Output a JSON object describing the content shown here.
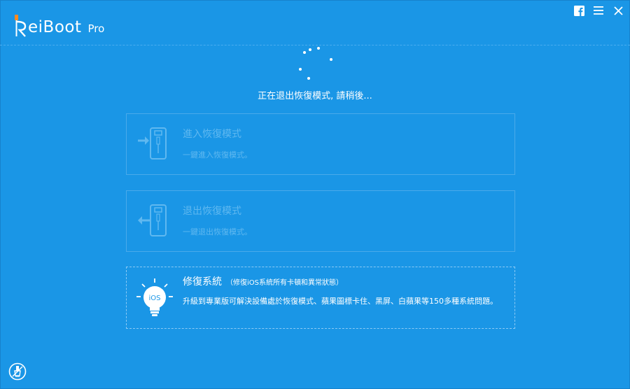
{
  "app": {
    "logo_main": "eiBoot",
    "logo_pro": "Pro"
  },
  "window_controls": [
    "facebook-icon",
    "menu-icon",
    "close-icon"
  ],
  "status_text": "正在退出恢復模式, 請稍後...",
  "cards": [
    {
      "title": "進入恢復模式",
      "desc": "一鍵進入恢復模式。",
      "icon": "phone-enter-icon",
      "enabled": false
    },
    {
      "title": "退出恢復模式",
      "desc": "一鍵退出恢復模式。",
      "icon": "phone-exit-icon",
      "enabled": false
    },
    {
      "title": "修復系統",
      "subtitle": "（修復iOS系統所有卡頓和異常狀態）",
      "desc": "升級到專業版可解決設備處於恢復模式、蘋果圖標卡住、黑屏、白蘋果等150多種系統問題。",
      "icon": "ios-lightbulb-icon",
      "icon_label": "iOS",
      "enabled": true
    }
  ],
  "colors": {
    "background": "#1a96e6",
    "disabled_text": "#5fb8f0",
    "active_text": "#ffffff"
  },
  "footer_icon": "brush-icon"
}
